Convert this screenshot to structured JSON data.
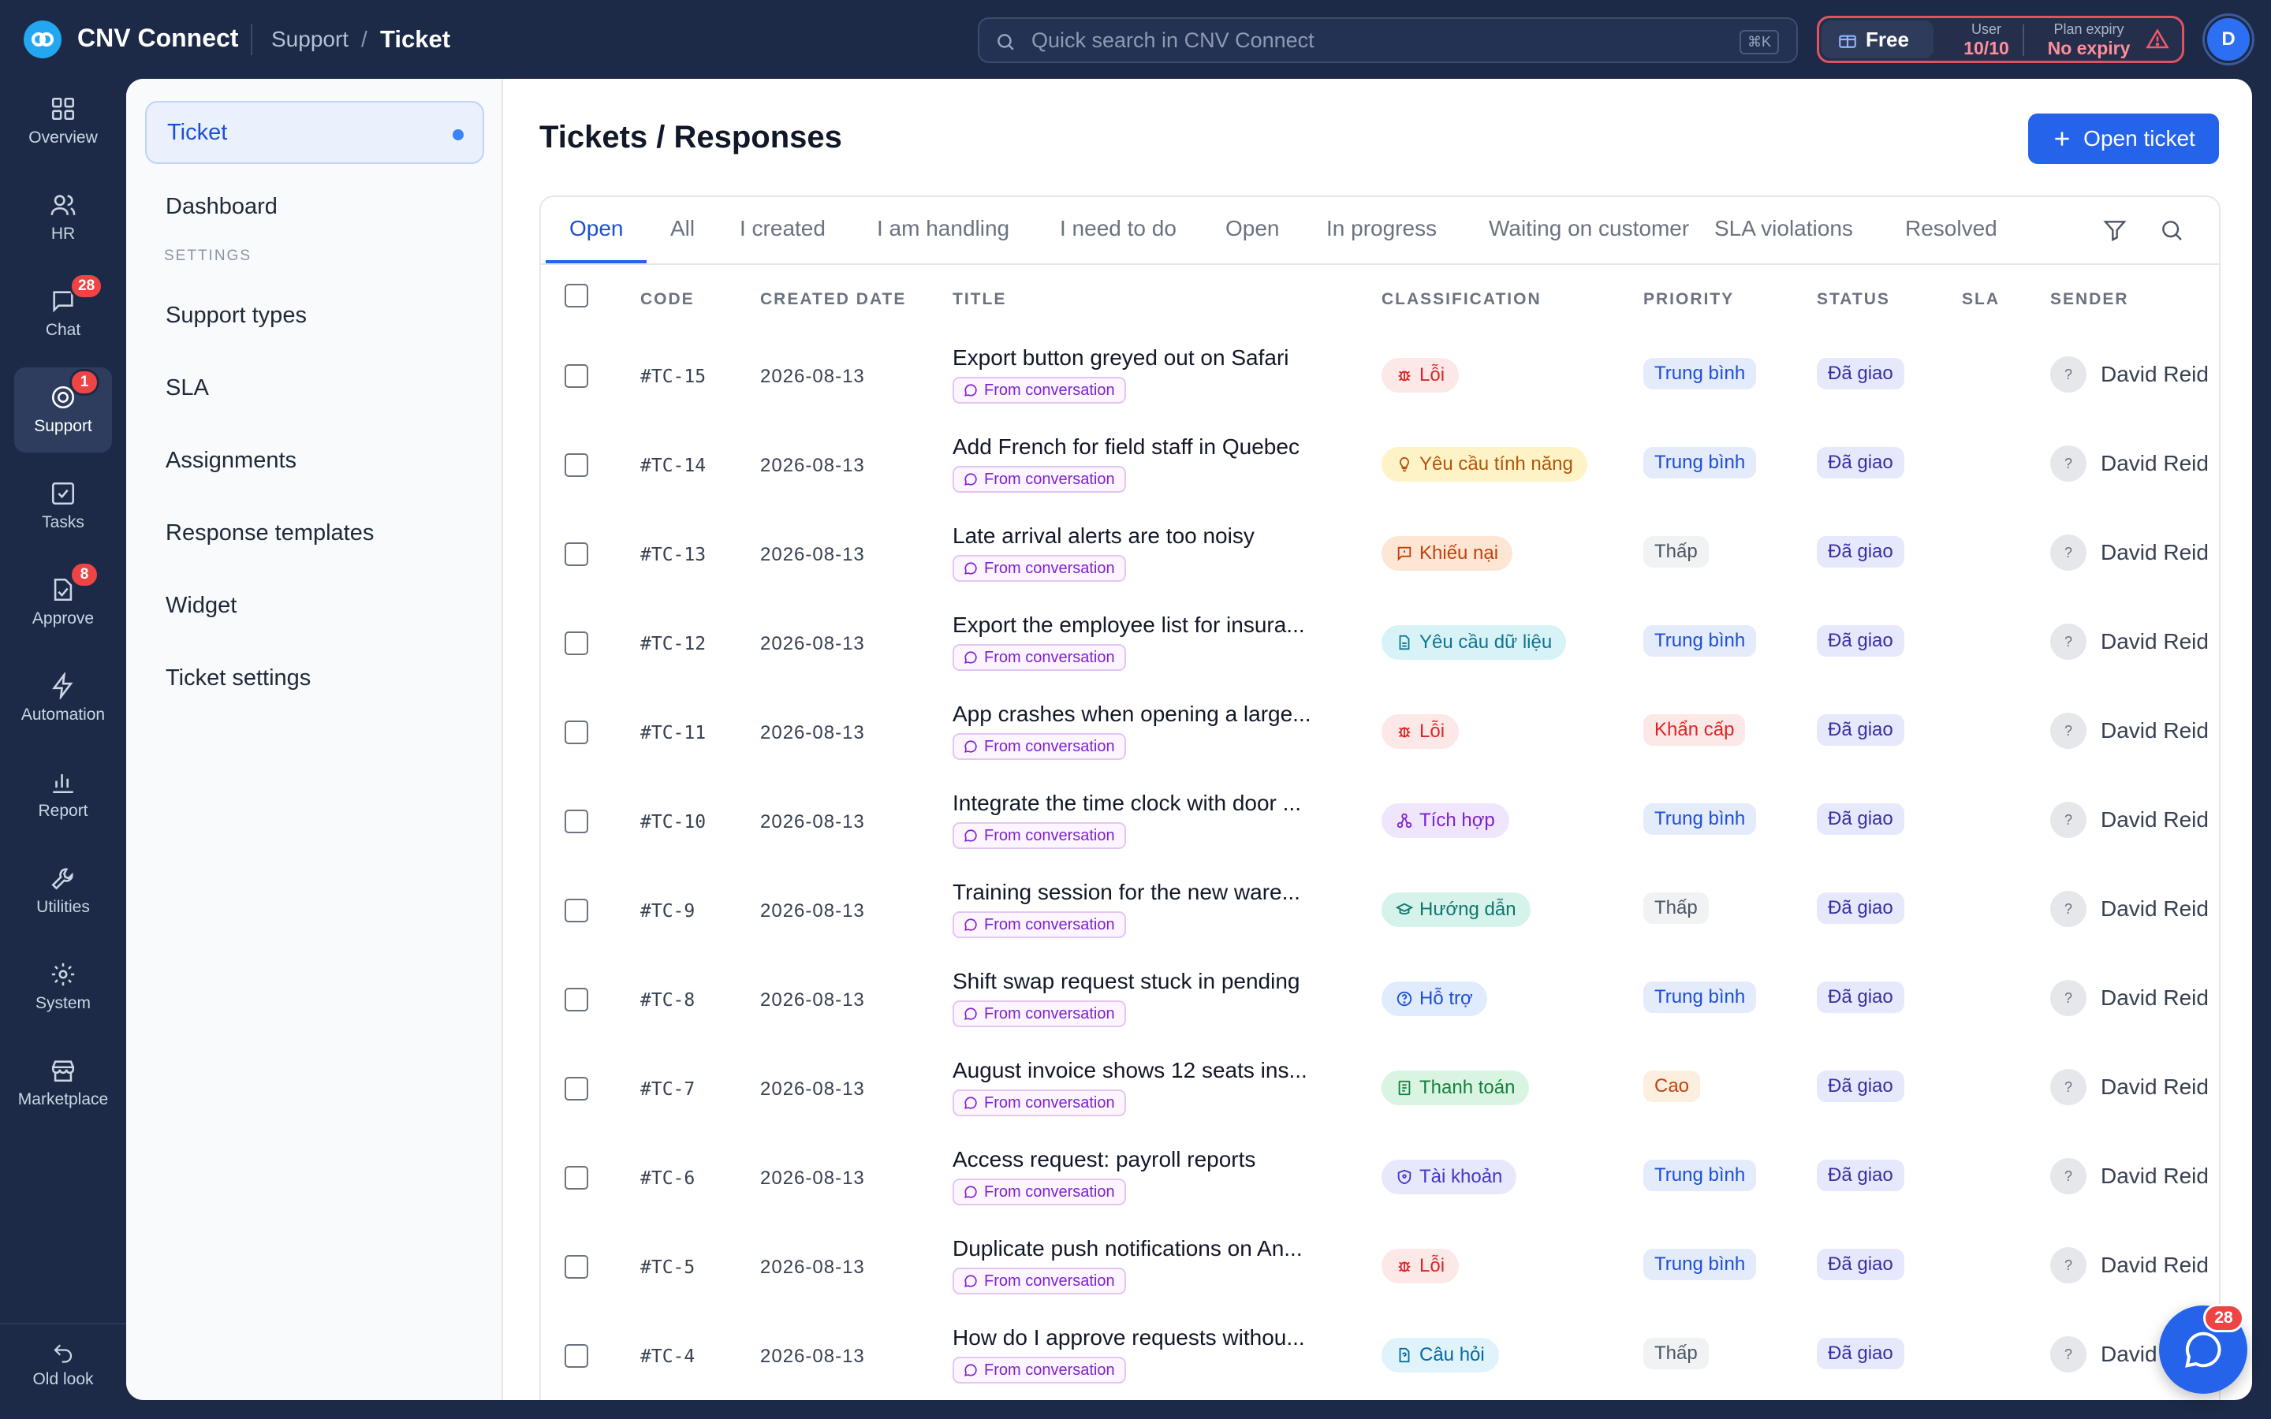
{
  "app": {
    "name": "CNV Connect"
  },
  "breadcrumb": {
    "parent": "Support",
    "separator": "/",
    "current": "Ticket"
  },
  "search": {
    "placeholder": "Quick search in CNV Connect",
    "shortcut": "⌘K"
  },
  "plan": {
    "name": "Free",
    "user_label": "User",
    "user_value": "10/10",
    "expiry_label": "Plan expiry",
    "expiry_value": "No expiry"
  },
  "avatar": {
    "initial": "D"
  },
  "rail": [
    {
      "label": "Overview",
      "icon": "grid-icon"
    },
    {
      "label": "HR",
      "icon": "users-icon"
    },
    {
      "label": "Chat",
      "icon": "chat-icon",
      "badge": "28"
    },
    {
      "label": "Support",
      "icon": "support-icon",
      "badge": "1",
      "active": true
    },
    {
      "label": "Tasks",
      "icon": "check-square-icon"
    },
    {
      "label": "Approve",
      "icon": "approve-icon",
      "badge": "8"
    },
    {
      "label": "Automation",
      "icon": "bolt-icon"
    },
    {
      "label": "Report",
      "icon": "bar-chart-icon"
    },
    {
      "label": "Utilities",
      "icon": "wrench-icon"
    },
    {
      "label": "System",
      "icon": "gear-icon"
    },
    {
      "label": "Marketplace",
      "icon": "store-icon"
    }
  ],
  "old_look": "Old look",
  "subnav": {
    "items": [
      "Ticket",
      "Dashboard"
    ],
    "section": "SETTINGS",
    "settings": [
      "Support types",
      "SLA",
      "Assignments",
      "Response templates",
      "Widget",
      "Ticket settings"
    ]
  },
  "main": {
    "title": "Tickets / Responses",
    "open_button": "Open ticket"
  },
  "tabs": [
    "Open",
    "All",
    "I created",
    "I am handling",
    "I need to do",
    "Open",
    "In progress",
    "Waiting on customer",
    "SLA violations",
    "Resolved"
  ],
  "columns": [
    "CODE",
    "CREATED DATE",
    "TITLE",
    "CLASSIFICATION",
    "PRIORITY",
    "STATUS",
    "SLA",
    "SENDER"
  ],
  "tag_from_conversation": "From conversation",
  "colors": {
    "bug": "#fde8e8",
    "feature": "#fdf3c7",
    "complaint": "#fde6d4",
    "data": "#d8f3f7",
    "integration": "#efe5fc",
    "guide": "#d5f3ea",
    "support": "#e0ebfd",
    "payment": "#d9f5e2",
    "account": "#e8e8fd",
    "question": "#e0f2fa",
    "accent": "#2563eb",
    "sidebar": "#1c2a47"
  },
  "rows": [
    {
      "code": "#TC-15",
      "date": "2026-08-13",
      "title": "Export button greyed out on Safari",
      "class": "Lỗi",
      "class_kind": "bug",
      "priority": "Trung bình",
      "priority_kind": "medium",
      "status": "Đã giao",
      "sender": "David Reid"
    },
    {
      "code": "#TC-14",
      "date": "2026-08-13",
      "title": "Add French for field staff in Quebec",
      "class": "Yêu cầu tính năng",
      "class_kind": "feature",
      "priority": "Trung bình",
      "priority_kind": "medium",
      "status": "Đã giao",
      "sender": "David Reid"
    },
    {
      "code": "#TC-13",
      "date": "2026-08-13",
      "title": "Late arrival alerts are too noisy",
      "class": "Khiếu nại",
      "class_kind": "complaint",
      "priority": "Thấp",
      "priority_kind": "low",
      "status": "Đã giao",
      "sender": "David Reid"
    },
    {
      "code": "#TC-12",
      "date": "2026-08-13",
      "title": "Export the employee list for insura...",
      "class": "Yêu cầu dữ liệu",
      "class_kind": "data",
      "priority": "Trung bình",
      "priority_kind": "medium",
      "status": "Đã giao",
      "sender": "David Reid"
    },
    {
      "code": "#TC-11",
      "date": "2026-08-13",
      "title": "App crashes when opening a large...",
      "class": "Lỗi",
      "class_kind": "bug",
      "priority": "Khẩn cấp",
      "priority_kind": "urgent",
      "status": "Đã giao",
      "sender": "David Reid"
    },
    {
      "code": "#TC-10",
      "date": "2026-08-13",
      "title": "Integrate the time clock with door ...",
      "class": "Tích hợp",
      "class_kind": "integration",
      "priority": "Trung bình",
      "priority_kind": "medium",
      "status": "Đã giao",
      "sender": "David Reid"
    },
    {
      "code": "#TC-9",
      "date": "2026-08-13",
      "title": "Training session for the new ware...",
      "class": "Hướng dẫn",
      "class_kind": "guide",
      "priority": "Thấp",
      "priority_kind": "low",
      "status": "Đã giao",
      "sender": "David Reid"
    },
    {
      "code": "#TC-8",
      "date": "2026-08-13",
      "title": "Shift swap request stuck in pending",
      "class": "Hỗ trợ",
      "class_kind": "support",
      "priority": "Trung bình",
      "priority_kind": "medium",
      "status": "Đã giao",
      "sender": "David Reid"
    },
    {
      "code": "#TC-7",
      "date": "2026-08-13",
      "title": "August invoice shows 12 seats ins...",
      "class": "Thanh toán",
      "class_kind": "payment",
      "priority": "Cao",
      "priority_kind": "high",
      "status": "Đã giao",
      "sender": "David Reid"
    },
    {
      "code": "#TC-6",
      "date": "2026-08-13",
      "title": "Access request: payroll reports",
      "class": "Tài khoản",
      "class_kind": "account",
      "priority": "Trung bình",
      "priority_kind": "medium",
      "status": "Đã giao",
      "sender": "David Reid"
    },
    {
      "code": "#TC-5",
      "date": "2026-08-13",
      "title": "Duplicate push notifications on An...",
      "class": "Lỗi",
      "class_kind": "bug",
      "priority": "Trung bình",
      "priority_kind": "medium",
      "status": "Đã giao",
      "sender": "David Reid"
    },
    {
      "code": "#TC-4",
      "date": "2026-08-13",
      "title": "How do I approve requests withou...",
      "class": "Câu hỏi",
      "class_kind": "question",
      "priority": "Thấp",
      "priority_kind": "low",
      "status": "Đã giao",
      "sender": "David"
    }
  ],
  "chat_fab_badge": "28"
}
